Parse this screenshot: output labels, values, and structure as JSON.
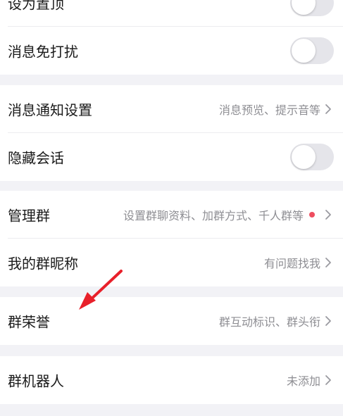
{
  "group1": {
    "rows": [
      {
        "label": "设为置顶",
        "toggle_on": false
      },
      {
        "label": "消息免打扰",
        "toggle_on": false
      }
    ]
  },
  "group2": {
    "rows": [
      {
        "label": "消息通知设置",
        "value": "消息预览、提示音等",
        "icon": "chevron-right-icon"
      },
      {
        "label": "隐藏会话",
        "toggle_on": false
      }
    ]
  },
  "group3": {
    "rows": [
      {
        "label": "管理群",
        "value": "设置群聊资料、加群方式、千人群等",
        "badge": "red-dot",
        "icon": "chevron-right-icon"
      },
      {
        "label": "我的群昵称",
        "value": "有问题找我",
        "icon": "chevron-right-icon"
      }
    ]
  },
  "group4": {
    "rows": [
      {
        "label": "群荣誉",
        "value": "群互动标识、群头衔",
        "icon": "chevron-right-icon"
      }
    ]
  },
  "group5": {
    "rows": [
      {
        "label": "群机器人",
        "value": "未添加",
        "icon": "chevron-right-icon"
      }
    ]
  },
  "colors": {
    "background": "#f2f2f6",
    "row": "#ffffff",
    "label": "#1a1a1a",
    "secondary": "#8e8e93",
    "toggle_off": "#e5e5ea",
    "badge": "#ee4d5f",
    "annotation_arrow": "#e8202a"
  },
  "annotation": {
    "icon": "red-arrow-icon",
    "points_to": "群荣誉"
  }
}
